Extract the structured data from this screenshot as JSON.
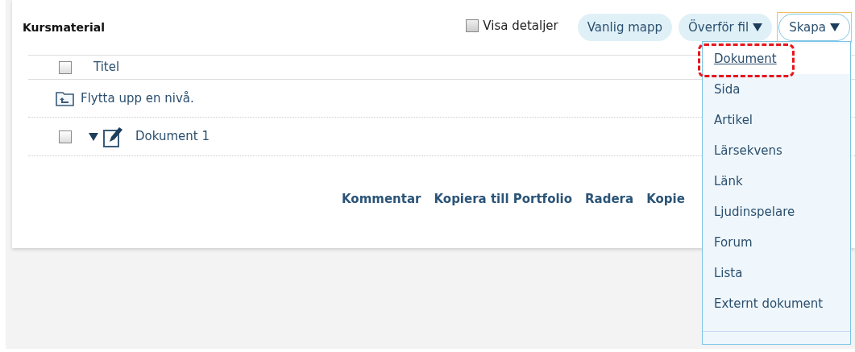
{
  "panel": {
    "title": "Kursmaterial"
  },
  "show_details": {
    "label": "Visa detaljer",
    "checked": false
  },
  "toolbar_buttons": [
    {
      "label": "Vanlig mapp",
      "dropdown": false,
      "open": false
    },
    {
      "label": "Överför fil",
      "dropdown": true,
      "open": false
    },
    {
      "label": "Skapa",
      "dropdown": true,
      "open": true
    }
  ],
  "table": {
    "header": {
      "label": "Titel",
      "checked": false
    },
    "up_row": {
      "label": "Flytta upp en nivå."
    },
    "rows": [
      {
        "title": "Dokument 1",
        "checked": false,
        "expanded": true
      }
    ]
  },
  "actions": [
    "Kommentar",
    "Kopiera till Portfolio",
    "Radera",
    "Kopie"
  ],
  "create_menu": [
    {
      "label": "Dokument",
      "selected": true,
      "highlighted": true
    },
    {
      "label": "Sida",
      "selected": false,
      "highlighted": false
    },
    {
      "label": "Artikel",
      "selected": false,
      "highlighted": false
    },
    {
      "label": "Lärsekvens",
      "selected": false,
      "highlighted": false
    },
    {
      "label": "Länk",
      "selected": false,
      "highlighted": false
    },
    {
      "label": "Ljudinspelare",
      "selected": false,
      "highlighted": false
    },
    {
      "label": "Forum",
      "selected": false,
      "highlighted": false
    },
    {
      "label": "Lista",
      "selected": false,
      "highlighted": false
    },
    {
      "label": "Externt dokument",
      "selected": false,
      "highlighted": false
    }
  ]
}
